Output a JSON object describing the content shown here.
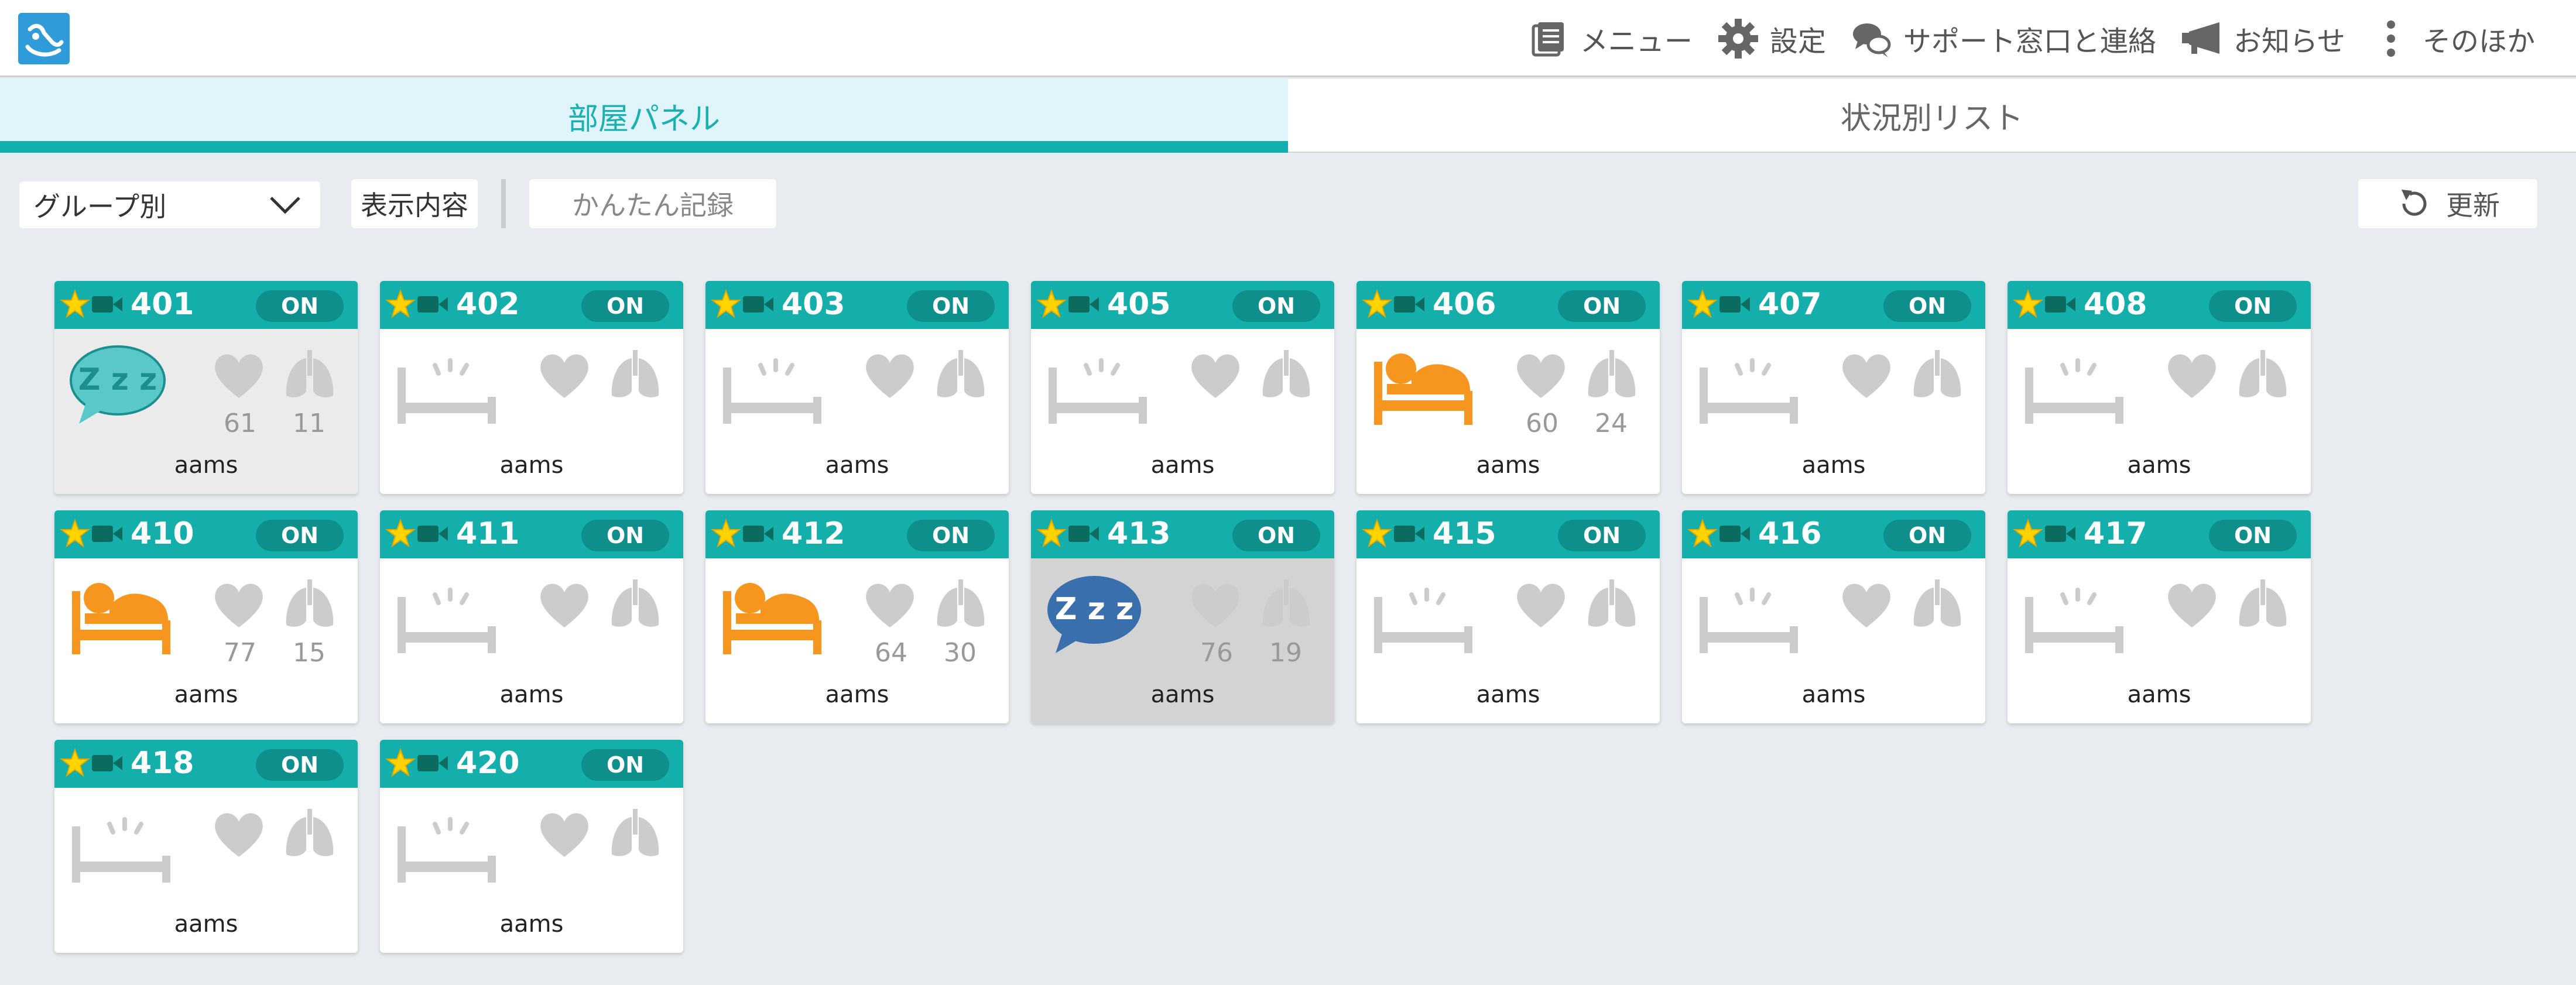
{
  "header": {
    "nav": [
      {
        "icon": "menu-icon",
        "label": "メニュー"
      },
      {
        "icon": "gear-icon",
        "label": "設定"
      },
      {
        "icon": "chat-icon",
        "label": "サポート窓口と連絡"
      },
      {
        "icon": "megaphone-icon",
        "label": "お知らせ"
      },
      {
        "icon": "more-icon",
        "label": "そのほか"
      }
    ]
  },
  "tabs": [
    {
      "label": "部屋パネル",
      "active": true
    },
    {
      "label": "状況別リスト",
      "active": false
    }
  ],
  "toolbar": {
    "group_select": "グループ別",
    "display_button": "表示内容",
    "easy_record_button": "かんたん記録",
    "refresh_button": "更新"
  },
  "colors": {
    "accent": "#14aeab",
    "sleep_light": "#5ac8c8",
    "sleep_dark": "#3a6fae",
    "in_bed": "#f7961e",
    "inactive": "#cccccc"
  },
  "rooms": [
    {
      "room": "401",
      "status": "ON",
      "name": "aams",
      "state": "sleep-light",
      "hr": "61",
      "rr": "11"
    },
    {
      "room": "402",
      "status": "ON",
      "name": "aams",
      "state": "empty",
      "hr": "",
      "rr": ""
    },
    {
      "room": "403",
      "status": "ON",
      "name": "aams",
      "state": "empty",
      "hr": "",
      "rr": ""
    },
    {
      "room": "405",
      "status": "ON",
      "name": "aams",
      "state": "empty",
      "hr": "",
      "rr": ""
    },
    {
      "room": "406",
      "status": "ON",
      "name": "aams",
      "state": "in-bed",
      "hr": "60",
      "rr": "24"
    },
    {
      "room": "407",
      "status": "ON",
      "name": "aams",
      "state": "empty",
      "hr": "",
      "rr": ""
    },
    {
      "room": "408",
      "status": "ON",
      "name": "aams",
      "state": "empty",
      "hr": "",
      "rr": ""
    },
    {
      "room": "410",
      "status": "ON",
      "name": "aams",
      "state": "in-bed",
      "hr": "77",
      "rr": "15"
    },
    {
      "room": "411",
      "status": "ON",
      "name": "aams",
      "state": "empty",
      "hr": "",
      "rr": ""
    },
    {
      "room": "412",
      "status": "ON",
      "name": "aams",
      "state": "in-bed",
      "hr": "64",
      "rr": "30"
    },
    {
      "room": "413",
      "status": "ON",
      "name": "aams",
      "state": "sleep-dark",
      "hr": "76",
      "rr": "19"
    },
    {
      "room": "415",
      "status": "ON",
      "name": "aams",
      "state": "empty",
      "hr": "",
      "rr": ""
    },
    {
      "room": "416",
      "status": "ON",
      "name": "aams",
      "state": "empty",
      "hr": "",
      "rr": ""
    },
    {
      "room": "417",
      "status": "ON",
      "name": "aams",
      "state": "empty",
      "hr": "",
      "rr": ""
    },
    {
      "room": "418",
      "status": "ON",
      "name": "aams",
      "state": "empty",
      "hr": "",
      "rr": ""
    },
    {
      "room": "420",
      "status": "ON",
      "name": "aams",
      "state": "empty",
      "hr": "",
      "rr": ""
    }
  ]
}
